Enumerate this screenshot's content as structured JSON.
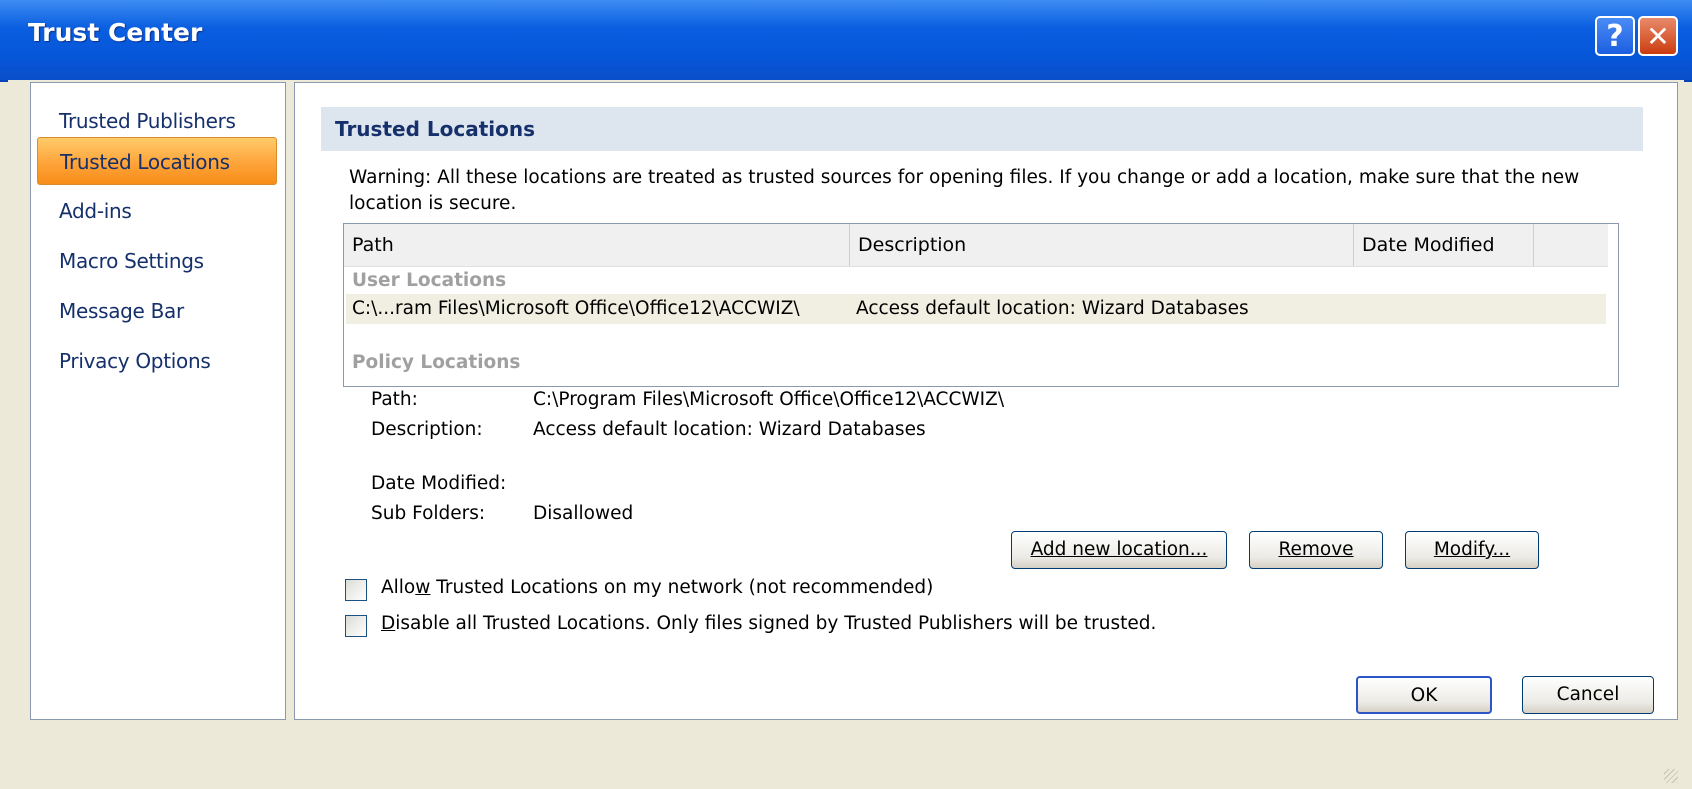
{
  "window": {
    "title": "Trust Center",
    "help_glyph": "?",
    "close_glyph": "✕"
  },
  "sidebar": {
    "items": [
      {
        "label": "Trusted Publishers",
        "active": false
      },
      {
        "label": "Trusted Locations",
        "active": true
      },
      {
        "label": "Add-ins",
        "active": false
      },
      {
        "label": "Macro Settings",
        "active": false
      },
      {
        "label": "Message Bar",
        "active": false
      },
      {
        "label": "Privacy Options",
        "active": false
      }
    ]
  },
  "main": {
    "section_title": "Trusted Locations",
    "warning": "Warning: All these locations are treated as trusted sources for opening files.  If you change or add a location, make sure that the new location is secure.",
    "table": {
      "columns": [
        "Path",
        "Description",
        "Date Modified"
      ],
      "user_group_label": "User Locations",
      "rows": [
        {
          "path": "C:\\...ram Files\\Microsoft Office\\Office12\\ACCWIZ\\",
          "description": "Access default location: Wizard Databases",
          "date_modified": ""
        }
      ],
      "policy_group_label": "Policy Locations"
    },
    "details": {
      "path_label": "Path:",
      "path_value": "C:\\Program Files\\Microsoft Office\\Office12\\ACCWIZ\\",
      "description_label": "Description:",
      "description_value": "Access default location: Wizard Databases",
      "date_modified_label": "Date Modified:",
      "date_modified_value": "",
      "sub_folders_label": "Sub Folders:",
      "sub_folders_value": "Disallowed"
    },
    "buttons": {
      "add_pre": "Add new location...",
      "remove": "Remove",
      "modify": "Modify..."
    },
    "checkboxes": {
      "allow_network": {
        "pre": "Allo",
        "u": "w",
        "post": " Trusted Locations on my network (not recommended)",
        "checked": false
      },
      "disable_all": {
        "pre": "",
        "u": "D",
        "post": "isable all Trusted Locations. Only files signed by Trusted Publishers will be trusted.",
        "checked": false
      }
    }
  },
  "footer": {
    "ok": "OK",
    "cancel": "Cancel"
  },
  "colors": {
    "titlebar": "#0656d9",
    "active_nav": "#fea43a",
    "section_header_bg": "#dde5ef",
    "label_text": "#15306b"
  }
}
